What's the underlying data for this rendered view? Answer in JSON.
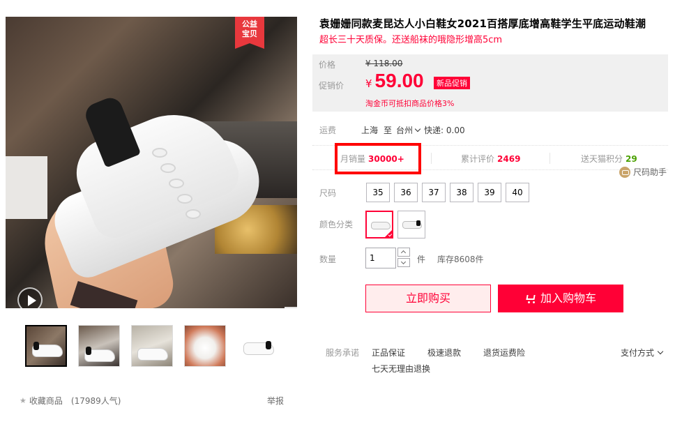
{
  "gallery": {
    "badge": "公益\n宝贝",
    "badge_line1": "公益",
    "badge_line2": "宝贝",
    "thumbnails": [
      "thumb-1",
      "thumb-2",
      "thumb-3",
      "thumb-4",
      "thumb-5"
    ]
  },
  "footer_left": {
    "favorite": "收藏商品",
    "popularity": "(17989人气)",
    "report": "举报"
  },
  "product": {
    "title": "袁姗姗同款麦昆达人小白鞋女2021百搭厚底增高鞋学生平底运动鞋潮",
    "subtitle": "超长三十天质保。还送船袜的哦隐形增高5cm"
  },
  "price": {
    "original_label": "价格",
    "original_value": "¥ 118.00",
    "promo_label": "促销价",
    "currency": "¥",
    "promo_value": "59.00",
    "promo_tag": "新品促销",
    "coin_note": "淘金币可抵扣商品价格3%"
  },
  "shipping": {
    "label": "运费",
    "from": "上海",
    "to_word": "至",
    "to": "台州",
    "express": "快递: 0.00"
  },
  "stats": {
    "monthly_sales_label": "月销量",
    "monthly_sales_value": "30000+",
    "reviews_label": "累计评价",
    "reviews_value": "2469",
    "points_label": "送天猫积分",
    "points_value": "29",
    "size_helper": "尺码助手"
  },
  "size": {
    "label": "尺码",
    "options": [
      "35",
      "36",
      "37",
      "38",
      "39",
      "40"
    ]
  },
  "color": {
    "label": "颜色分类",
    "selected_index": 0
  },
  "quantity": {
    "label": "数量",
    "value": "1",
    "unit": "件",
    "stock": "库存8608件"
  },
  "actions": {
    "buy_now": "立即购买",
    "add_cart": "加入购物车"
  },
  "service": {
    "label": "服务承诺",
    "items": [
      "正品保证",
      "极速退款",
      "退货运费险",
      "七天无理由退换"
    ],
    "payment": "支付方式"
  },
  "colors": {
    "accent": "#ff0036",
    "highlight": "#ff0000",
    "points_green": "#4aa000"
  }
}
